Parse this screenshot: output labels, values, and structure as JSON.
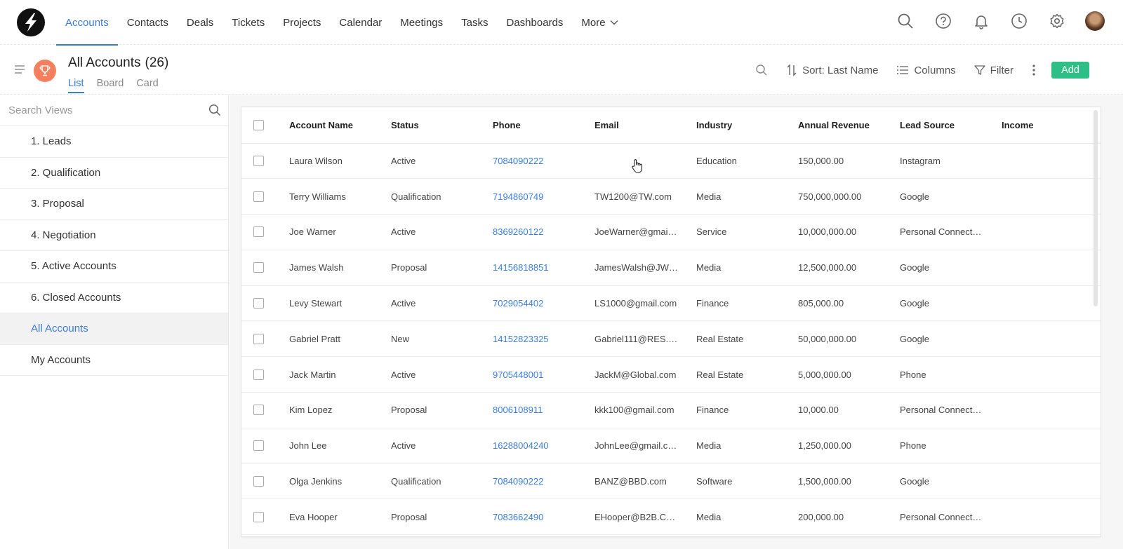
{
  "nav": {
    "items": [
      {
        "label": "Accounts",
        "active": true
      },
      {
        "label": "Contacts"
      },
      {
        "label": "Deals"
      },
      {
        "label": "Tickets"
      },
      {
        "label": "Projects"
      },
      {
        "label": "Calendar"
      },
      {
        "label": "Meetings"
      },
      {
        "label": "Tasks"
      },
      {
        "label": "Dashboards"
      }
    ],
    "more_label": "More",
    "icons": [
      "search-icon",
      "help-icon",
      "bell-icon",
      "clock-icon",
      "gear-icon",
      "avatar"
    ]
  },
  "header": {
    "title": "All Accounts",
    "count": "(26)",
    "tabs": [
      {
        "label": "List",
        "active": true
      },
      {
        "label": "Board"
      },
      {
        "label": "Card"
      }
    ],
    "sort_label": "Sort: Last Name",
    "columns_label": "Columns",
    "filter_label": "Filter",
    "add_label": "Add"
  },
  "sidebar": {
    "search_placeholder": "Search Views",
    "items": [
      {
        "label": "1. Leads"
      },
      {
        "label": "2. Qualification"
      },
      {
        "label": "3. Proposal"
      },
      {
        "label": "4. Negotiation"
      },
      {
        "label": "5. Active Accounts"
      },
      {
        "label": "6. Closed Accounts"
      },
      {
        "label": "All Accounts",
        "active": true
      },
      {
        "label": "My Accounts"
      }
    ]
  },
  "table": {
    "columns": [
      "Account Name",
      "Status",
      "Phone",
      "Email",
      "Industry",
      "Annual Revenue",
      "Lead Source",
      "Income"
    ],
    "rows": [
      [
        "Laura Wilson",
        "Active",
        "7084090222",
        "",
        "Education",
        "150,000.00",
        "Instagram",
        ""
      ],
      [
        "Terry Williams",
        "Qualification",
        "7194860749",
        "TW1200@TW.com",
        "Media",
        "750,000,000.00",
        "Google",
        ""
      ],
      [
        "Joe Warner",
        "Active",
        "8369260122",
        "JoeWarner@gmai…",
        "Service",
        "10,000,000.00",
        "Personal Connect…",
        ""
      ],
      [
        "James Walsh",
        "Proposal",
        "14156818851",
        "JamesWalsh@JW…",
        "Media",
        "12,500,000.00",
        "Google",
        ""
      ],
      [
        "Levy Stewart",
        "Active",
        "7029054402",
        "LS1000@gmail.com",
        "Finance",
        "805,000.00",
        "Google",
        ""
      ],
      [
        "Gabriel Pratt",
        "New",
        "14152823325",
        "Gabriel111@RES.…",
        "Real Estate",
        "50,000,000.00",
        "Google",
        ""
      ],
      [
        "Jack Martin",
        "Active",
        "9705448001",
        "JackM@Global.com",
        "Real Estate",
        "5,000,000.00",
        "Phone",
        ""
      ],
      [
        "Kim Lopez",
        "Proposal",
        "8006108911",
        "kkk100@gmail.com",
        "Finance",
        "10,000.00",
        "Personal Connect…",
        ""
      ],
      [
        "John Lee",
        "Active",
        "16288004240",
        "JohnLee@gmail.c…",
        "Media",
        "1,250,000.00",
        "Phone",
        ""
      ],
      [
        "Olga Jenkins",
        "Qualification",
        "7084090222",
        "BANZ@BBD.com",
        "Software",
        "1,500,000.00",
        "Google",
        ""
      ],
      [
        "Eva Hooper",
        "Proposal",
        "7083662490",
        "EHooper@B2B.C…",
        "Media",
        "200,000.00",
        "Personal Connect…",
        ""
      ]
    ]
  },
  "colors": {
    "accent": "#3b7ddd",
    "add_button": "#2fbf86",
    "trophy_badge": "#f47f5c"
  }
}
